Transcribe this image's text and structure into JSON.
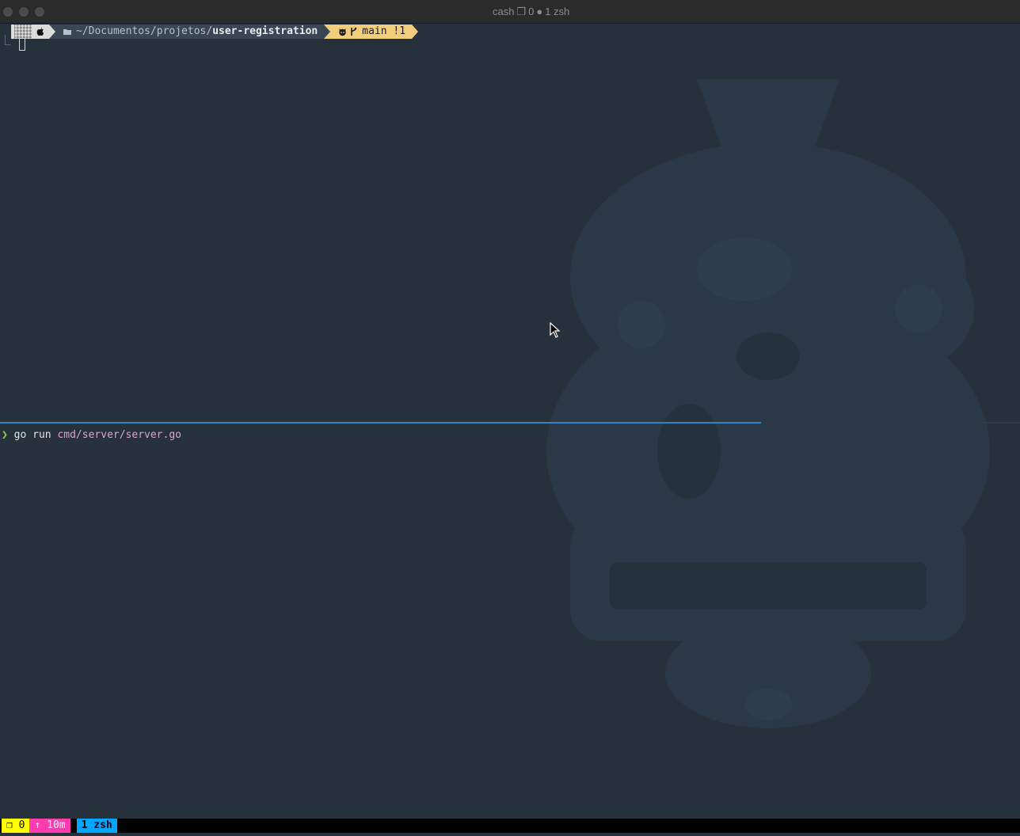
{
  "titlebar": {
    "session_name": "cash",
    "windows_icon": "❐",
    "windows_count": "0",
    "active_dot": "●",
    "active_window": "1 zsh"
  },
  "prompt": {
    "os_icon": "apple-icon",
    "folder_icon": "folder-icon",
    "dir_prefix": "~/Documentos/projetos/",
    "dir_current": "user-registration",
    "git_host_icon": "github-icon",
    "branch_icon": "branch-icon",
    "branch": "main",
    "status": "!1"
  },
  "command": {
    "arrow": "❯",
    "program": "go run ",
    "path": "cmd/server/server.go"
  },
  "statusbar": {
    "session": "❐ 0",
    "uptime": "↑ 10m",
    "window": "1 zsh"
  },
  "colors": {
    "background": "#27313c",
    "divider_active": "#2a86c5",
    "git_segment": "#f2cd7c",
    "session_badge": "#ffff00",
    "uptime_badge": "#ff3bb0",
    "window_badge": "#00a6ff"
  }
}
